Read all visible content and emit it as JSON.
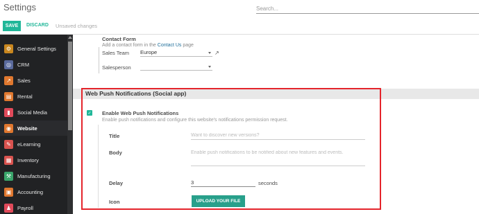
{
  "header": {
    "title": "Settings",
    "search_placeholder": "Search..."
  },
  "actions": {
    "save_label": "SAVE",
    "discard_label": "DISCARD",
    "status": "Unsaved changes"
  },
  "sidebar": {
    "items": [
      {
        "label": "General Settings",
        "icon": "gear-icon",
        "color": "#c9871f",
        "glyph": "⚙"
      },
      {
        "label": "CRM",
        "icon": "crm-icon",
        "color": "#5a6a9c",
        "glyph": "◎"
      },
      {
        "label": "Sales",
        "icon": "sales-icon",
        "color": "#e0782f",
        "glyph": "↗"
      },
      {
        "label": "Rental",
        "icon": "rental-icon",
        "color": "#e0782f",
        "glyph": "▤"
      },
      {
        "label": "Social Media",
        "icon": "social-media-icon",
        "color": "#e04a5a",
        "glyph": "▮"
      },
      {
        "label": "Website",
        "icon": "website-icon",
        "color": "#e0782f",
        "glyph": "◉"
      },
      {
        "label": "eLearning",
        "icon": "elearning-icon",
        "color": "#d9534f",
        "glyph": "✎"
      },
      {
        "label": "Inventory",
        "icon": "inventory-icon",
        "color": "#d9534f",
        "glyph": "▦"
      },
      {
        "label": "Manufacturing",
        "icon": "manufacturing-icon",
        "color": "#3aa56b",
        "glyph": "⚒"
      },
      {
        "label": "Accounting",
        "icon": "accounting-icon",
        "color": "#e0782f",
        "glyph": "▣"
      },
      {
        "label": "Payroll",
        "icon": "payroll-icon",
        "color": "#e04a5a",
        "glyph": "♟"
      }
    ],
    "active_label": "Website"
  },
  "contact_form": {
    "title": "Contact Form",
    "desc_prefix": "Add a contact form in the",
    "desc_link": "Contact Us",
    "desc_suffix": "page",
    "sales_team_label": "Sales Team",
    "sales_team_value": "Europe",
    "salesperson_label": "Salesperson",
    "salesperson_value": ""
  },
  "section": {
    "title": "Web Push Notifications (Social app)"
  },
  "push": {
    "checkbox_checked": true,
    "title": "Enable Web Push Notifications",
    "description": "Enable push notifications and configure this website's notifications permission request.",
    "title_label": "Title",
    "title_placeholder": "Want to discover new versions?",
    "body_label": "Body",
    "body_placeholder": "Enable push notifications to be notified about new features and events.",
    "delay_label": "Delay",
    "delay_value": "3",
    "delay_unit": "seconds",
    "icon_label": "Icon",
    "upload_label": "UPLOAD YOUR FILE"
  },
  "colors": {
    "accent": "#21b799",
    "highlight_border": "#e4242b",
    "sidebar_bg": "#212224"
  }
}
